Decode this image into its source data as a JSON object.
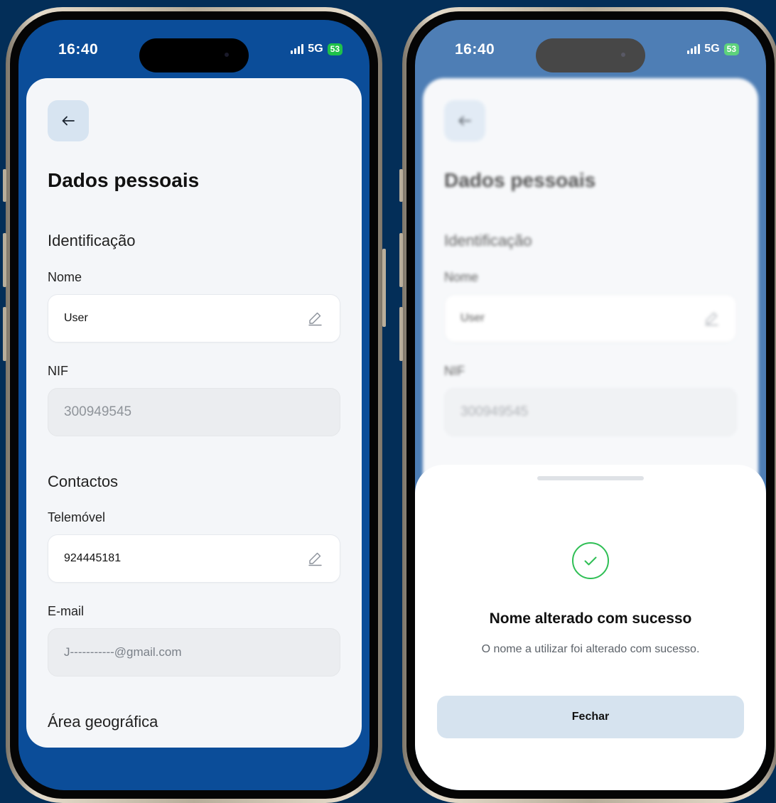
{
  "colors": {
    "background": "#032e58",
    "screen_blue": "#0b4d99",
    "card": "#f4f6f9",
    "back_button": "#d7e4f1",
    "primary_button": "#d6e3ef",
    "success_green": "#2fbf55",
    "battery_green": "#1fc14a"
  },
  "status_bar": {
    "time": "16:40",
    "network": "5G",
    "battery": "53"
  },
  "form": {
    "title": "Dados pessoais",
    "sections": {
      "identification": "Identificação",
      "contacts": "Contactos",
      "area": "Área geográfica"
    },
    "name": {
      "label": "Nome",
      "value": "User"
    },
    "nif": {
      "label": "NIF",
      "value": "300949545"
    },
    "phone": {
      "label": "Telemóvel",
      "value": "924445181"
    },
    "email": {
      "label": "E-mail",
      "value": "J-----------@gmail.com"
    }
  },
  "success_sheet": {
    "title": "Nome alterado com sucesso",
    "message": "O nome a utilizar foi alterado com sucesso.",
    "close_label": "Fechar"
  },
  "icons": {
    "back": "arrow-left-icon",
    "edit": "pencil-icon",
    "success": "check-circle-icon",
    "signal": "signal-bars-icon"
  }
}
